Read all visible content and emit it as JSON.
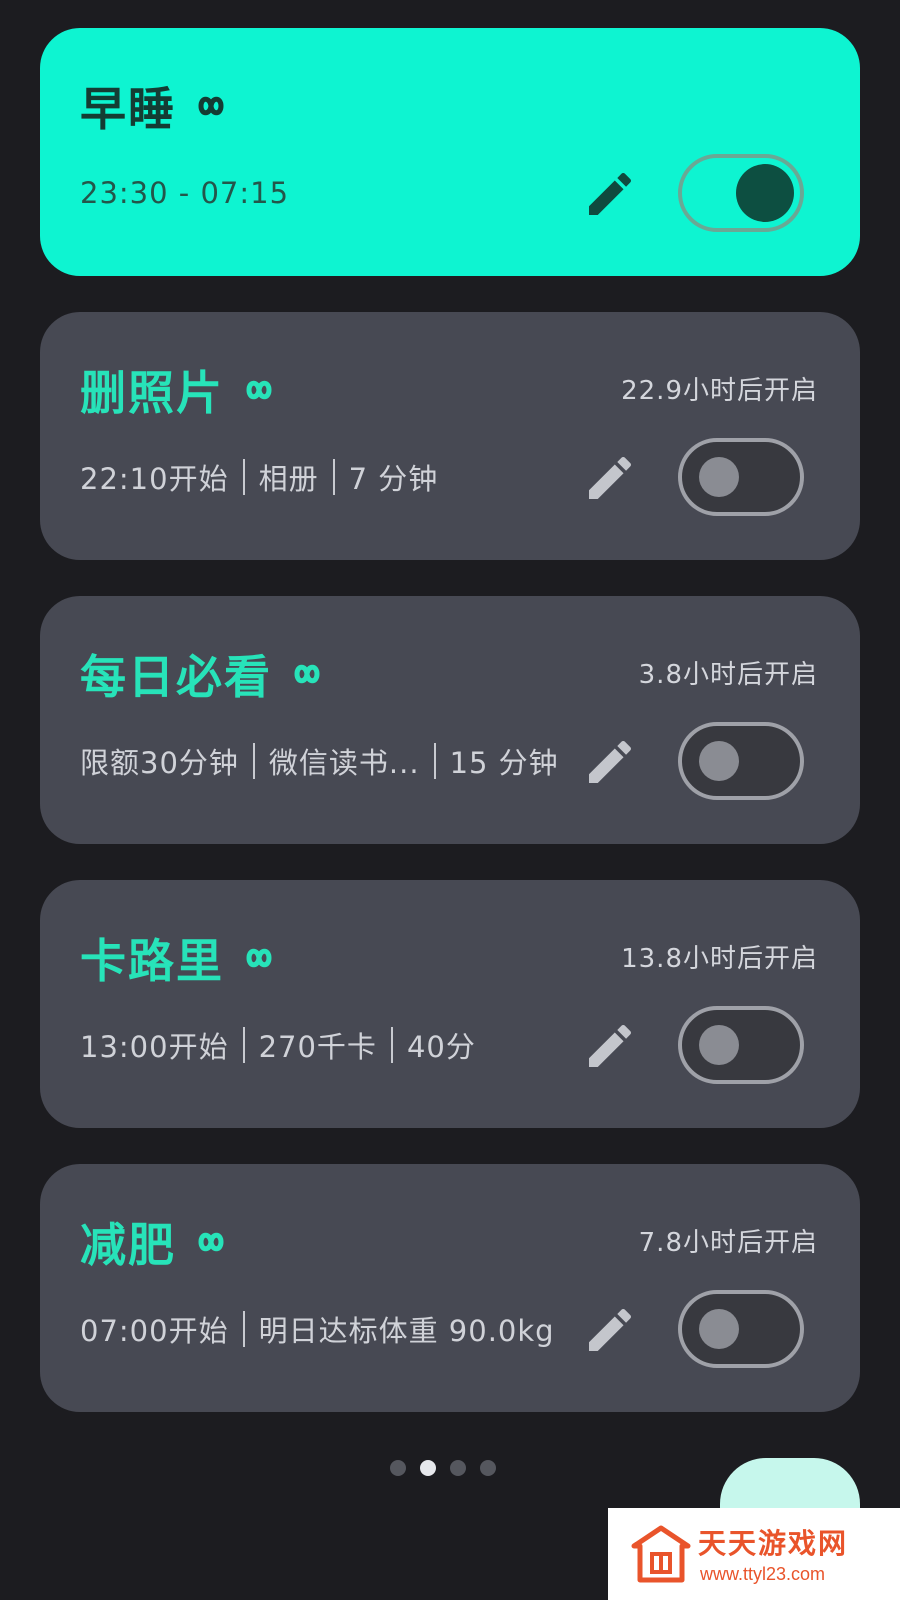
{
  "colors": {
    "background": "#1c1c20",
    "card": "#474953",
    "active_card": "#0ef4d1",
    "accent_title": "#27e3b9"
  },
  "cards": [
    {
      "title": "早睡",
      "icon": "infinity-icon",
      "countdown": "",
      "info": [
        "23:30 - 07:15"
      ],
      "enabled": true
    },
    {
      "title": "删照片",
      "icon": "infinity-icon",
      "countdown": "22.9小时后开启",
      "info": [
        "22:10开始",
        "相册",
        "7 分钟"
      ],
      "enabled": false
    },
    {
      "title": "每日必看",
      "icon": "infinity-icon",
      "countdown": "3.8小时后开启",
      "info": [
        "限额30分钟",
        "微信读书...",
        "15 分钟"
      ],
      "enabled": false
    },
    {
      "title": "卡路里",
      "icon": "infinity-icon",
      "countdown": "13.8小时后开启",
      "info": [
        "13:00开始",
        "270千卡",
        "40分"
      ],
      "enabled": false
    },
    {
      "title": "减肥",
      "icon": "infinity-icon",
      "countdown": "7.8小时后开启",
      "info": [
        "07:00开始",
        "明日达标体重 90.0kg"
      ],
      "enabled": false
    }
  ],
  "pager": {
    "pages": 4,
    "current": 2
  },
  "watermark": {
    "title": "天天游戏网",
    "url": "www.ttyl23.com"
  }
}
